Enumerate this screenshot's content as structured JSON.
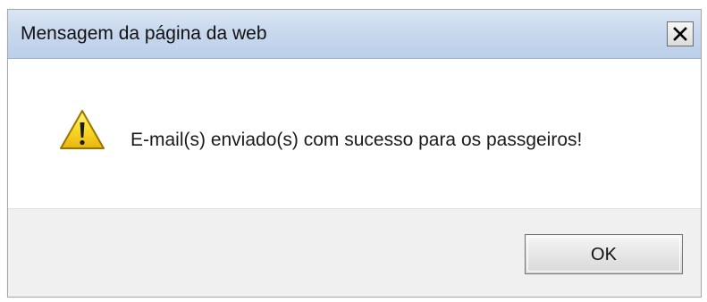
{
  "dialog": {
    "title": "Mensagem da página da web",
    "close_icon": "close-x-icon",
    "message_icon": "warning-triangle-icon",
    "message": "E-mail(s) enviado(s) com sucesso para os passgeiros!",
    "ok_label": "OK"
  },
  "colors": {
    "titlebar_top": "#dbe6f4",
    "titlebar_bottom": "#bccfe9",
    "footer_bg": "#f0f0f0",
    "warning_yellow": "#f7d51e"
  }
}
